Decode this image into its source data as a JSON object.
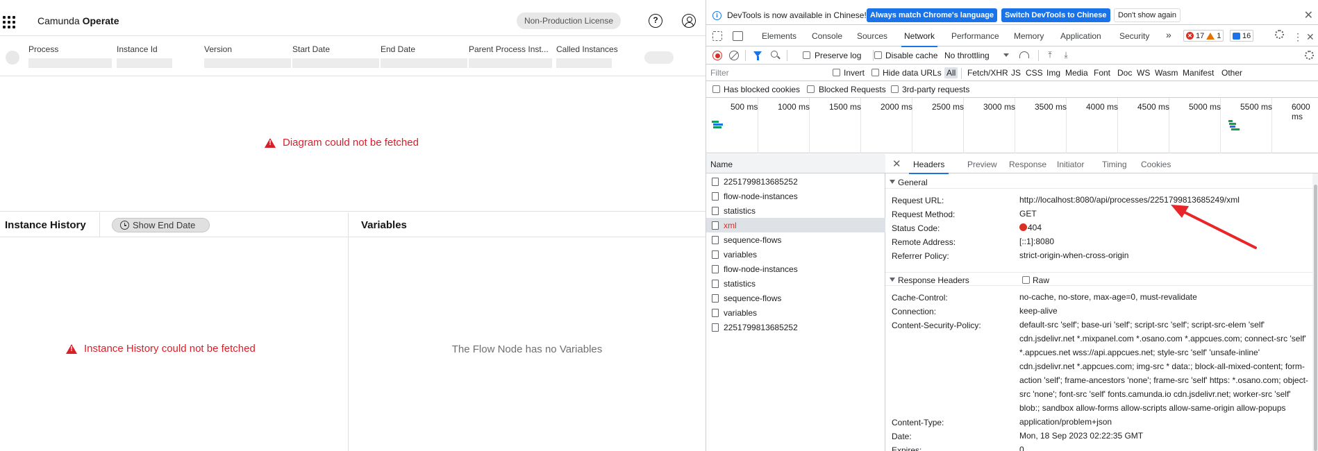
{
  "operate": {
    "brand_prefix": "Camunda",
    "brand_name": "Operate",
    "license_badge": "Non-Production License",
    "columns": [
      "Process",
      "Instance Id",
      "Version",
      "Start Date",
      "End Date",
      "Parent Process Inst...",
      "Called Instances"
    ],
    "diagram_error": "Diagram could not be fetched",
    "history_title": "Instance History",
    "show_end_date": "Show End Date",
    "history_error": "Instance History could not be fetched",
    "variables_title": "Variables",
    "no_variables": "The Flow Node has no Variables"
  },
  "devtools": {
    "infobar": {
      "text": "DevTools is now available in Chinese!",
      "btn_match": "Always match Chrome's language",
      "btn_switch": "Switch DevTools to Chinese",
      "btn_dismiss": "Don't show again"
    },
    "tabs": [
      "Elements",
      "Console",
      "Sources",
      "Network",
      "Performance",
      "Memory",
      "Application",
      "Security"
    ],
    "more_tabs": "»",
    "errors": "17",
    "warnings": "1",
    "messages": "16",
    "toolbar": {
      "preserve_log": "Preserve log",
      "disable_cache": "Disable cache",
      "throttling": "No throttling"
    },
    "filter": {
      "placeholder": "Filter",
      "invert": "Invert",
      "hide_data_urls": "Hide data URLs",
      "types": [
        "All",
        "Fetch/XHR",
        "JS",
        "CSS",
        "Img",
        "Media",
        "Font",
        "Doc",
        "WS",
        "Wasm",
        "Manifest",
        "Other"
      ],
      "blocked_cookies": "Has blocked cookies",
      "blocked_requests": "Blocked Requests",
      "third_party": "3rd-party requests"
    },
    "timeline_ticks": [
      "500 ms",
      "1000 ms",
      "1500 ms",
      "2000 ms",
      "2500 ms",
      "3000 ms",
      "3500 ms",
      "4000 ms",
      "4500 ms",
      "5000 ms",
      "5500 ms",
      "6000 ms"
    ],
    "name_header": "Name",
    "requests": [
      "2251799813685252",
      "flow-node-instances",
      "statistics",
      "xml",
      "sequence-flows",
      "variables",
      "flow-node-instances",
      "statistics",
      "sequence-flows",
      "variables",
      "2251799813685252"
    ],
    "selected_request": "xml",
    "detail_tabs": [
      "Headers",
      "Preview",
      "Response",
      "Initiator",
      "Timing",
      "Cookies"
    ],
    "general": {
      "title": "General",
      "rows": [
        {
          "key": "Request URL:",
          "value": "http://localhost:8080/api/processes/2251799813685249/xml"
        },
        {
          "key": "Request Method:",
          "value": "GET"
        },
        {
          "key": "Status Code:",
          "value": "404"
        },
        {
          "key": "Remote Address:",
          "value": "[::1]:8080"
        },
        {
          "key": "Referrer Policy:",
          "value": "strict-origin-when-cross-origin"
        }
      ]
    },
    "response_headers": {
      "title": "Response Headers",
      "raw": "Raw",
      "rows": [
        {
          "key": "Cache-Control:",
          "value": "no-cache, no-store, max-age=0, must-revalidate"
        },
        {
          "key": "Connection:",
          "value": "keep-alive"
        },
        {
          "key": "Content-Security-Policy:",
          "value": "default-src 'self'; base-uri 'self'; script-src 'self'; script-src-elem 'self' cdn.jsdelivr.net *.mixpanel.com *.osano.com *.appcues.com; connect-src 'self' *.appcues.net wss://api.appcues.net; style-src 'self' 'unsafe-inline' cdn.jsdelivr.net *.appcues.com; img-src * data:; block-all-mixed-content; form-action 'self'; frame-ancestors 'none'; frame-src 'self' https: *.osano.com; object-src 'none'; font-src 'self' fonts.camunda.io cdn.jsdelivr.net; worker-src 'self' blob:; sandbox allow-forms allow-scripts allow-same-origin allow-popups"
        },
        {
          "key": "Content-Type:",
          "value": "application/problem+json"
        },
        {
          "key": "Date:",
          "value": "Mon, 18 Sep 2023 02:22:35 GMT"
        },
        {
          "key": "Expires:",
          "value": "0"
        }
      ]
    }
  },
  "annotation_color": "#e8262a"
}
